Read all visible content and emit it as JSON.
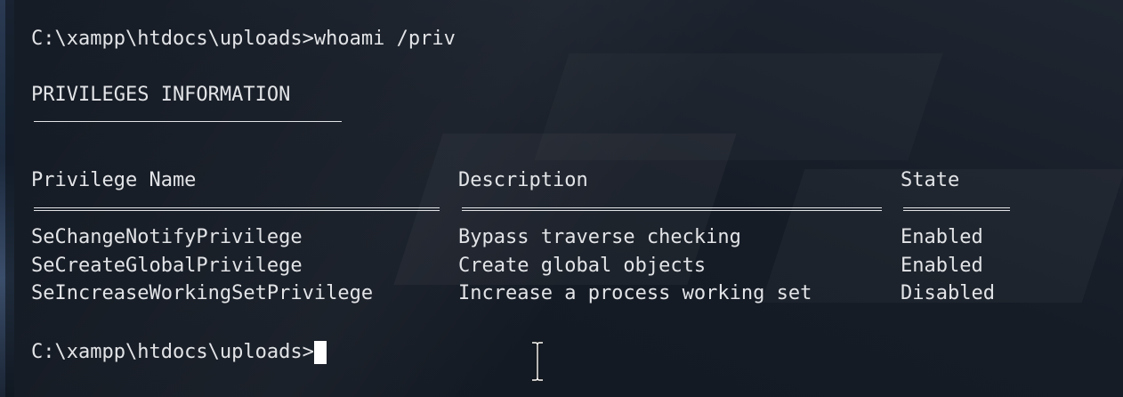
{
  "terminal": {
    "command_line": "C:\\xampp\\htdocs\\uploads>whoami /priv",
    "section_title": "PRIVILEGES INFORMATION",
    "headers": {
      "name": "Privilege Name",
      "description": "Description",
      "state": "State"
    },
    "rows": [
      {
        "name": "SeChangeNotifyPrivilege",
        "description": "Bypass traverse checking",
        "state": "Enabled"
      },
      {
        "name": "SeCreateGlobalPrivilege",
        "description": "Create global objects",
        "state": "Enabled"
      },
      {
        "name": "SeIncreaseWorkingSetPrivilege",
        "description": "Increase a process working set",
        "state": "Disabled"
      }
    ],
    "prompt": "C:\\xampp\\htdocs\\uploads>",
    "text_color": "#e2e4e7",
    "background_color": "#161c26"
  },
  "icons": {
    "text_cursor": "i-beam-cursor-icon"
  }
}
